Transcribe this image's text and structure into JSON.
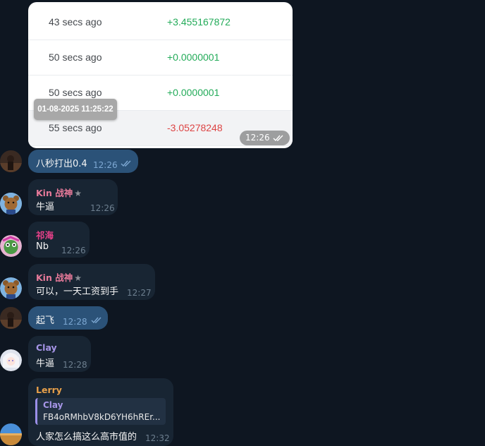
{
  "card": {
    "rows": [
      {
        "time": "43 secs ago",
        "value": "+3.455167872",
        "sign": "pos"
      },
      {
        "time": "50 secs ago",
        "value": "+0.0000001",
        "sign": "pos"
      },
      {
        "time": "50 secs ago",
        "value": "+0.0000001",
        "sign": "pos"
      },
      {
        "time": "55 secs ago",
        "value": "-3.05278248",
        "sign": "neg"
      }
    ],
    "time": "12:26",
    "tooltip": "01-08-2025 11:25:22"
  },
  "messages": [
    {
      "sender": "",
      "text": "八秒打出0.4",
      "time": "12:26",
      "outgoing": true
    },
    {
      "sender": "Kin 战神",
      "sender_color": "#e87a9a",
      "text": "牛逼",
      "time": "12:26"
    },
    {
      "sender": "祁海",
      "sender_color": "#e8418a",
      "text": "Nb",
      "time": "12:26"
    },
    {
      "sender": "Kin 战神",
      "sender_color": "#e87a9a",
      "text": "可以，一天工资到手",
      "time": "12:27"
    },
    {
      "sender": "",
      "text": "起飞",
      "time": "12:28",
      "outgoing": true
    },
    {
      "sender": "Clay",
      "sender_color": "#a695e7",
      "text": "牛逼",
      "time": "12:28"
    },
    {
      "sender": "Lerry",
      "sender_color": "#e8a04a",
      "quote_sender": "Clay",
      "quote_text": "FB4oRMhbV8kD6YH6hREr...",
      "text": "人家怎么搞这么高市值的",
      "time": "12:32"
    }
  ],
  "icons": {
    "star": "★",
    "double_check": "✓✓"
  }
}
